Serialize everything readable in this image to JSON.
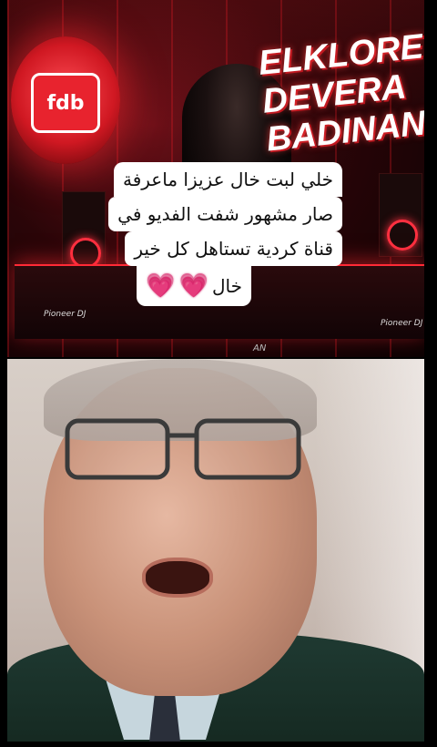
{
  "top_video": {
    "brand_logo_text": "fdb",
    "brand_title_lines": [
      "ELKLORE",
      "DEVERA",
      "BADINAN"
    ],
    "deck_label_left": "Pioneer DJ",
    "deck_label_right": "Pioneer DJ",
    "bottom_partial_text": "AN"
  },
  "caption": {
    "lines": [
      "خلي لبت خال عزيزا ماعرفة",
      "صار مشهور شفت الفديو في",
      "قناة كردية تستاهل كل خير"
    ],
    "last_line": "خال",
    "hearts": [
      "💗",
      "💗"
    ]
  },
  "colors": {
    "accent_red": "#e8232e",
    "heart_pink": "#ff2f7a",
    "sweater_green": "#1f3a32"
  }
}
